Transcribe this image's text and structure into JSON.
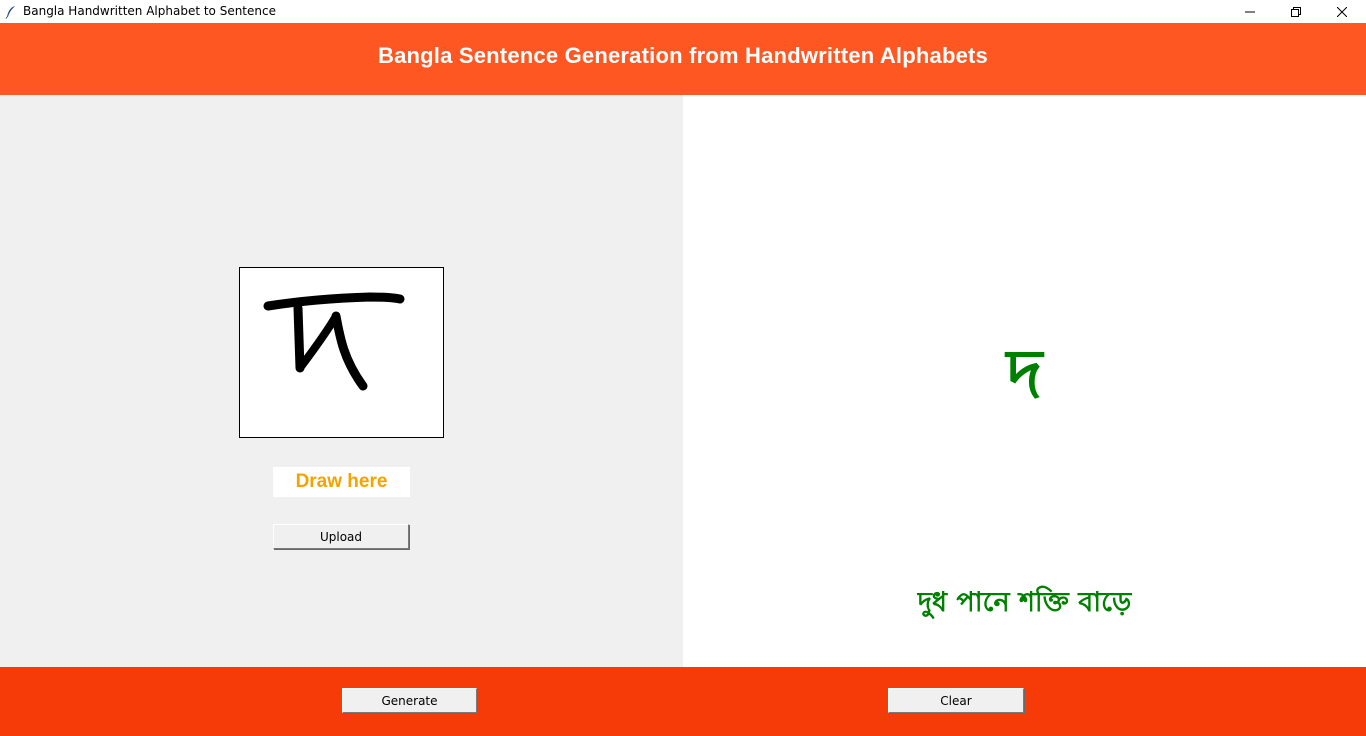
{
  "window": {
    "title": "Bangla Handwritten Alphabet to Sentence",
    "icons": {
      "app": "feather-icon",
      "minimize": "minimize-icon",
      "maximize": "restore-icon",
      "close": "close-icon"
    }
  },
  "header": {
    "title": "Bangla Sentence Generation from Handwritten Alphabets",
    "background": "#ff5722"
  },
  "left_panel": {
    "draw_label": "Draw here",
    "upload_label": "Upload",
    "label_color": "#f4a300"
  },
  "right_panel": {
    "predicted_letter": "দ",
    "sentence": "দুধ পানে শক্তি বাড়ে",
    "text_color": "#008000"
  },
  "footer": {
    "generate_label": "Generate",
    "clear_label": "Clear",
    "background": "#f73b08"
  }
}
